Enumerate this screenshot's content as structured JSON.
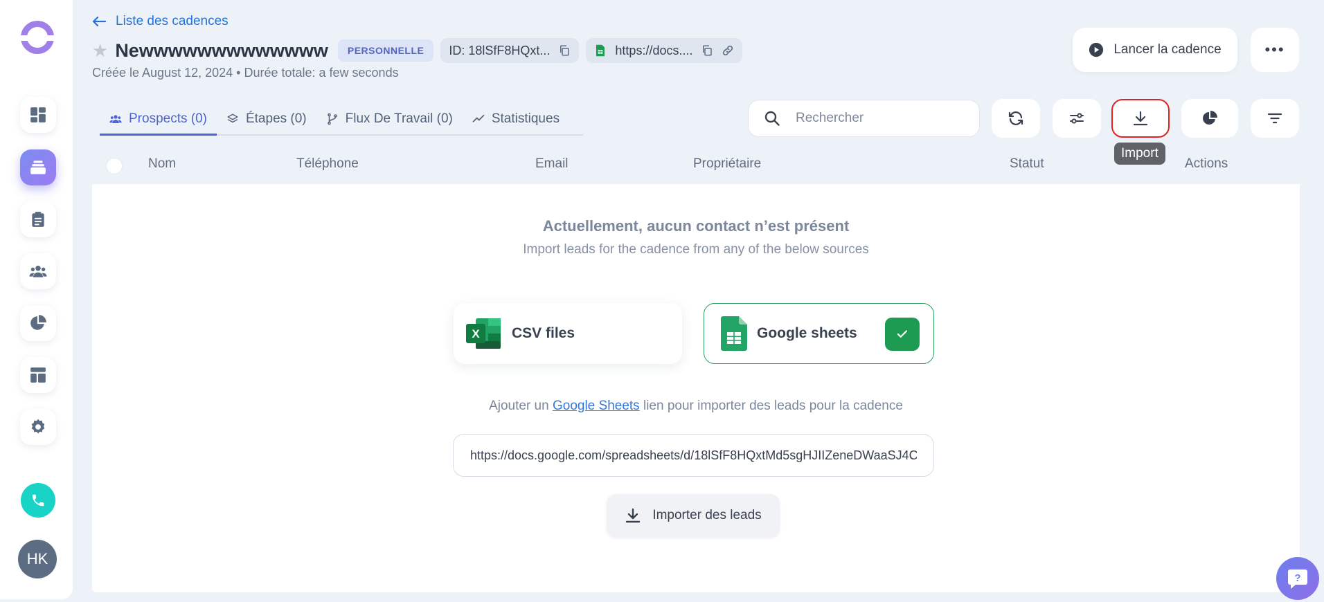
{
  "nav": {
    "back_label": "Liste des cadences",
    "avatar_initials": "HK"
  },
  "cadence": {
    "title": "Newwwwwwwwwwwww",
    "type_badge": "PERSONNELLE",
    "id_text": "ID: 18lSfF8HQxt...",
    "sheet_link_text": "https://docs....",
    "subtitle": "Créée le August 12, 2024 • Durée totale: a few seconds",
    "launch_label": "Lancer la cadence",
    "more_label": "•••"
  },
  "tabs": [
    {
      "label": "Prospects (0)",
      "icon": "users-icon",
      "active": true
    },
    {
      "label": "Étapes (0)",
      "icon": "layers-icon"
    },
    {
      "label": "Flux De Travail (0)",
      "icon": "workflow-icon"
    },
    {
      "label": "Statistiques",
      "icon": "trend-icon"
    }
  ],
  "search": {
    "placeholder": "Rechercher"
  },
  "toolbar": {
    "tooltip": "Import",
    "buttons": [
      "refresh-icon",
      "settings-sliders-icon",
      "download-icon",
      "pie-chart-icon",
      "filter-icon"
    ]
  },
  "table": {
    "columns": [
      "Nom",
      "Téléphone",
      "Email",
      "Propriétaire",
      "Statut",
      "Actions"
    ]
  },
  "empty": {
    "title": "Actuellement, aucun contact n’est présent",
    "subtitle": "Import leads for the cadence from any of the below sources"
  },
  "sources": {
    "csv_label": "CSV files",
    "gsheets_label": "Google sheets"
  },
  "import": {
    "helper_prefix": "Ajouter un ",
    "helper_link": "Google Sheets",
    "helper_suffix": " lien pour importer des leads pour la cadence",
    "url_value": "https://docs.google.com/spreadsheets/d/18lSfF8HQxtMd5sgHJIIZeneDWaaSJ4C",
    "button_label": "Importer des leads"
  },
  "colors": {
    "accent": "#4c63d2",
    "link": "#2672d8",
    "success": "#1e9b52",
    "highlight": "#e02222"
  }
}
